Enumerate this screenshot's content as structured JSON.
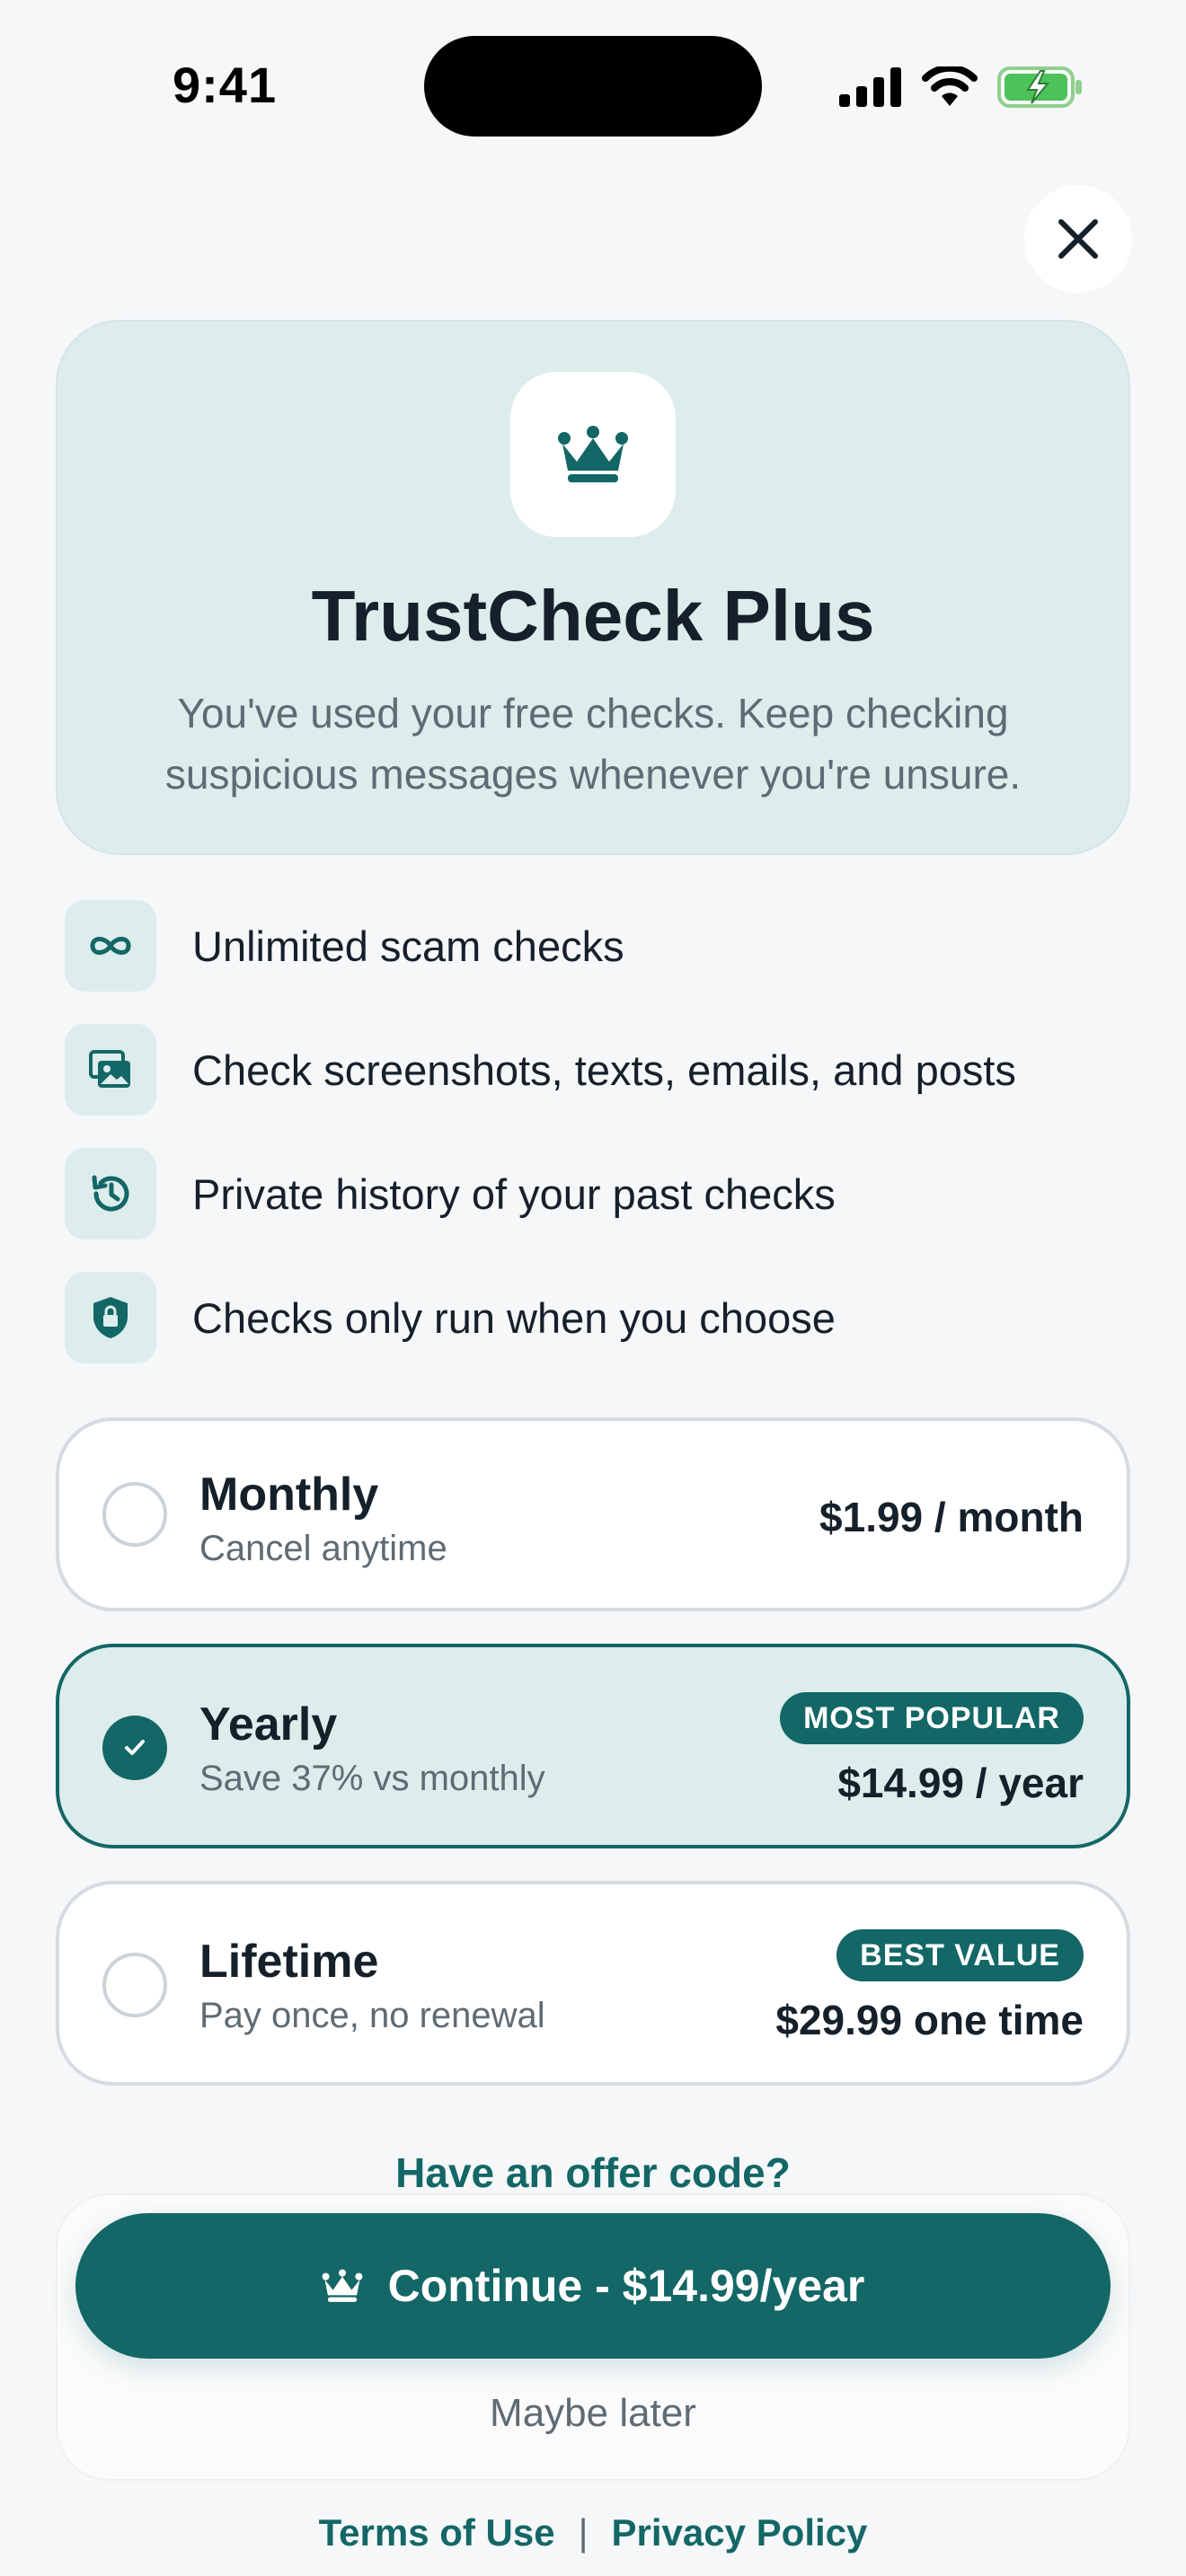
{
  "status_bar": {
    "time": "9:41"
  },
  "hero": {
    "icon": "crown-icon",
    "title": "TrustCheck Plus",
    "subtitle_line1": "You've used your free checks. Keep checking",
    "subtitle_line2": "suspicious messages whenever you're unsure."
  },
  "features": [
    {
      "icon": "infinity-icon",
      "label": "Unlimited scam checks"
    },
    {
      "icon": "photos-icon",
      "label": "Check screenshots, texts, emails, and posts"
    },
    {
      "icon": "history-icon",
      "label": "Private history of your past checks"
    },
    {
      "icon": "shield-lock-icon",
      "label": "Checks only run when you choose"
    }
  ],
  "plans": {
    "monthly": {
      "name": "Monthly",
      "desc": "Cancel anytime",
      "price": "$1.99 / month",
      "selected": false
    },
    "yearly": {
      "name": "Yearly",
      "desc": "Save 37% vs monthly",
      "price": "$14.99 / year",
      "badge": "MOST POPULAR",
      "selected": true
    },
    "lifetime": {
      "name": "Lifetime",
      "desc": "Pay once, no renewal",
      "price": "$29.99 one time",
      "badge": "BEST VALUE",
      "selected": false
    }
  },
  "offer_link": "Have an offer code?",
  "cta_label": "Continue - $14.99/year",
  "later_label": "Maybe later",
  "footer": {
    "terms": "Terms of Use",
    "separator": "|",
    "privacy": "Privacy Policy"
  },
  "colors": {
    "accent": "#136766",
    "tint": "#dcedec",
    "background": "#f5f7f9"
  }
}
